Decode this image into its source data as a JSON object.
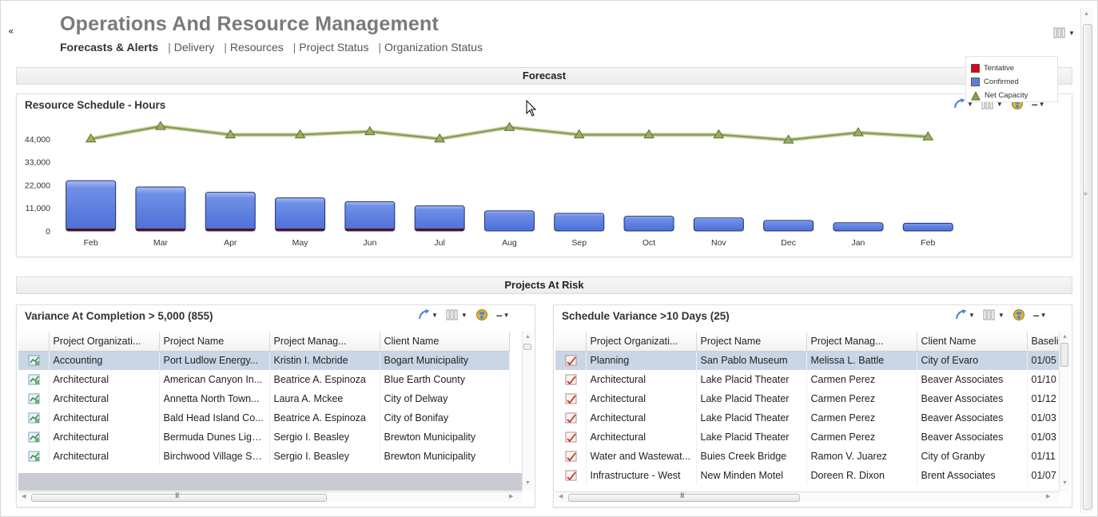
{
  "header": {
    "title": "Operations And Resource Management",
    "nav": [
      {
        "label": "Forecasts & Alerts",
        "active": true
      },
      {
        "label": "Delivery",
        "active": false
      },
      {
        "label": "Resources",
        "active": false
      },
      {
        "label": "Project Status",
        "active": false
      },
      {
        "label": "Organization Status",
        "active": false
      }
    ],
    "nav_separator": "|"
  },
  "sections": {
    "forecast": "Forecast",
    "projects_at_risk": "Projects At Risk"
  },
  "resource_chart": {
    "title": "Resource Schedule - Hours",
    "legend": [
      {
        "label": "Tentative",
        "color": "#e0001b"
      },
      {
        "label": "Confirmed",
        "color": "#5a7fe0"
      },
      {
        "label": "Net Capacity",
        "color": "#8aa052"
      }
    ]
  },
  "chart_data": {
    "type": "bar",
    "title": "Resource Schedule - Hours",
    "categories": [
      "Feb",
      "Mar",
      "Apr",
      "May",
      "Jun",
      "Jul",
      "Aug",
      "Sep",
      "Oct",
      "Nov",
      "Dec",
      "Jan",
      "Feb"
    ],
    "y_tick_labels": [
      "0",
      "11,000",
      "22,000",
      "33,000",
      "44,000"
    ],
    "ylim": [
      0,
      55000
    ],
    "series": [
      {
        "name": "Tentative",
        "kind": "bar",
        "values": [
          500,
          500,
          500,
          500,
          500,
          500,
          0,
          0,
          0,
          0,
          0,
          0,
          0
        ]
      },
      {
        "name": "Confirmed",
        "kind": "bar",
        "values": [
          24000,
          21000,
          18500,
          15800,
          14000,
          12000,
          9600,
          8400,
          7000,
          6200,
          5000,
          3900,
          3700
        ]
      },
      {
        "name": "Net Capacity",
        "kind": "line",
        "values": [
          44000,
          50000,
          46000,
          46000,
          47500,
          44000,
          49500,
          46000,
          46000,
          46000,
          43500,
          47000,
          45000
        ]
      }
    ],
    "legend": "right",
    "grid": false
  },
  "variance_panel": {
    "title": "Variance At Completion > 5,000 (855)",
    "columns": [
      "",
      "Project Organizati...",
      "Project Name",
      "Project Manag...",
      "Client Name"
    ],
    "rows": [
      [
        "Accounting",
        "Port Ludlow Energy...",
        "Kristin I. Mcbride",
        "Bogart Municipality"
      ],
      [
        "Architectural",
        "American Canyon In...",
        "Beatrice A. Espinoza",
        "Blue Earth County"
      ],
      [
        "Architectural",
        "Annetta North Town...",
        "Laura A. Mckee",
        "City of Delway"
      ],
      [
        "Architectural",
        "Bald Head Island Co...",
        "Beatrice A. Espinoza",
        "City of Bonifay"
      ],
      [
        "Architectural",
        "Bermuda Dunes Ligh...",
        "Sergio I. Beasley",
        "Brewton Municipality"
      ],
      [
        "Architectural",
        "Birchwood Village Se...",
        "Sergio I. Beasley",
        "Brewton Municipality"
      ]
    ],
    "selected_row": 0,
    "row_icon": "project-chart-icon"
  },
  "schedule_panel": {
    "title": "Schedule Variance >10 Days (25)",
    "columns": [
      "",
      "Project Organizati...",
      "Project Name",
      "Project Manag...",
      "Client Name",
      "Baseli"
    ],
    "rows": [
      [
        "Planning",
        "San Pablo Museum",
        "Melissa L. Battle",
        "City of Evaro",
        "01/05"
      ],
      [
        "Architectural",
        "Lake Placid Theater",
        "Carmen Perez",
        "Beaver Associates",
        "01/10"
      ],
      [
        "Architectural",
        "Lake Placid Theater",
        "Carmen Perez",
        "Beaver Associates",
        "01/12"
      ],
      [
        "Architectural",
        "Lake Placid Theater",
        "Carmen Perez",
        "Beaver Associates",
        "01/03"
      ],
      [
        "Architectural",
        "Lake Placid Theater",
        "Carmen Perez",
        "Beaver Associates",
        "01/03"
      ],
      [
        "Water and Wastewat...",
        "Buies Creek Bridge",
        "Ramon V. Juarez",
        "City of Granby",
        "01/11"
      ],
      [
        "Infrastructure - West",
        "New Minden Motel",
        "Doreen R. Dixon",
        "Brent Associates",
        "01/07"
      ]
    ],
    "selected_row": 0,
    "row_icon": "schedule-edit-icon"
  },
  "scroll_grip": "III"
}
